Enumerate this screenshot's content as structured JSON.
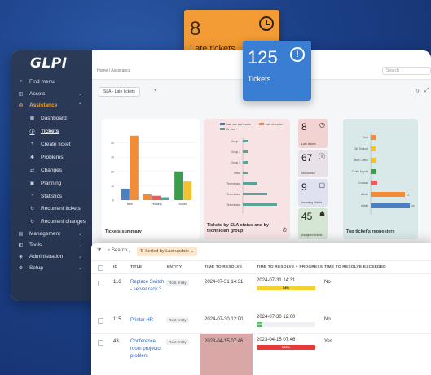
{
  "app": {
    "logo": "GLPI",
    "breadcrumb": "Home / Assistance",
    "search_placeholder": "Search"
  },
  "sidebar": {
    "items": [
      {
        "label": "Find menu",
        "icon": "search-icon"
      },
      {
        "label": "Assets",
        "icon": "box-icon"
      },
      {
        "label": "Assistance",
        "icon": "headset-icon"
      },
      {
        "label": "Dashboard",
        "icon": "dashboard-icon"
      },
      {
        "label": "Tickets",
        "icon": "alert-circle-icon"
      },
      {
        "label": "Create ticket",
        "icon": "plus-icon"
      },
      {
        "label": "Problems",
        "icon": "problem-icon"
      },
      {
        "label": "Changes",
        "icon": "changes-icon"
      },
      {
        "label": "Planning",
        "icon": "calendar-icon"
      },
      {
        "label": "Statistics",
        "icon": "statistics-icon"
      },
      {
        "label": "Recurrent tickets",
        "icon": "recurrent-icon"
      },
      {
        "label": "Recurrent changes",
        "icon": "recurrent-icon"
      },
      {
        "label": "Management",
        "icon": "wallet-icon"
      },
      {
        "label": "Tools",
        "icon": "briefcase-icon"
      },
      {
        "label": "Administration",
        "icon": "shield-icon"
      },
      {
        "label": "Setup",
        "icon": "gear-icon"
      }
    ]
  },
  "dashboard": {
    "selector": "SLA - Late tickets",
    "add": "+",
    "cards": {
      "summary_title": "Tickets summary",
      "sla_title": "Tickets by SLA status and by technician group",
      "requesters_title": "Top ticket's requesters"
    },
    "mini_cards": [
      {
        "value": "8",
        "label": "Late tickets",
        "color": "#f2d3d1"
      },
      {
        "value": "67",
        "label": "Not solved",
        "color": "#e8e1e7"
      },
      {
        "value": "9",
        "label": "Incoming tickets",
        "color": "#dfe0f0"
      },
      {
        "value": "45",
        "label": "Assigned tickets",
        "color": "#d6e6d4"
      }
    ]
  },
  "floating": {
    "late": {
      "value": "8",
      "label": "Late tickets",
      "color": "#f39c35"
    },
    "tickets": {
      "value": "125",
      "label": "Tickets",
      "color": "#3a7ed3"
    }
  },
  "table": {
    "search": "Search",
    "sorted": "Sorted by Last update",
    "columns": [
      "ID",
      "TITLE",
      "ENTITY",
      "TIME TO RESOLVE",
      "TIME TO RESOLVE + PROGRESS",
      "TIME TO RESOLVE EXCEEDED"
    ],
    "rows": [
      {
        "id": "116",
        "title": "Replace Switch - server rack 3",
        "entity": "Root entity",
        "ttr": "2024-07-31 14:31",
        "progress_date": "2024-07-31 14:31",
        "progress_pct": "54%",
        "progress_value": 0.54,
        "progress_color": "#f2d22e",
        "exceeded": "No"
      },
      {
        "id": "115",
        "title": "Printer HR",
        "entity": "Root entity",
        "ttr": "2024-07-30 12:00",
        "progress_date": "2024-07-30 12:00",
        "progress_pct": "10%",
        "progress_value": 0.1,
        "progress_color": "#44c15b",
        "exceeded": "No"
      },
      {
        "id": "43",
        "title": "Conference room projector problem",
        "entity": "Root entity",
        "ttr": "2023-04-15 07:46",
        "progress_date": "2023-04-15 07:46",
        "progress_pct": "100%",
        "progress_value": 1.0,
        "progress_color": "#e43b3b",
        "exceeded": "Yes"
      }
    ]
  },
  "chart_data": [
    {
      "type": "bar",
      "title": "Tickets summary",
      "categories": [
        "New",
        "Pending",
        "Solved"
      ],
      "ylim": [
        0,
        50
      ],
      "yticks": [
        "0",
        "10",
        "20",
        "30",
        "40"
      ],
      "series": [
        {
          "color": "#4b7fc0",
          "values": [
            8,
            0,
            0
          ]
        },
        {
          "color": "#f28c38",
          "values": [
            45,
            4,
            0
          ]
        },
        {
          "color": "#f05a5a",
          "values": [
            0,
            3,
            0
          ]
        },
        {
          "color": "#4aa79b",
          "values": [
            0,
            2,
            0
          ]
        },
        {
          "color": "#3a9d4a",
          "values": [
            0,
            0,
            20
          ]
        },
        {
          "color": "#f1c232",
          "values": [
            0,
            0,
            13
          ]
        }
      ]
    },
    {
      "type": "bar",
      "orientation": "horizontal",
      "title": "Tickets by SLA status and by technician group",
      "legend": [
        "Late own and resolve",
        "Late of resolve",
        "On time"
      ],
      "legend_colors": [
        "#4a77b5",
        "#f28c38",
        "#5aa39a"
      ],
      "categories": [
        "Group 1",
        "Group 2",
        "Group 3",
        "Office",
        "Technicians",
        "Technicians",
        "Technicians"
      ],
      "series": [
        {
          "name": "On time",
          "values": [
            1,
            1,
            1,
            1,
            3,
            5,
            7
          ]
        }
      ]
    },
    {
      "type": "bar",
      "orientation": "horizontal",
      "title": "Top ticket's requesters",
      "categories": [
        "Tech",
        "Glpi Support",
        "Marc Cotton",
        "Cedric Dupont",
        "Crosses",
        "Admin",
        "Admin"
      ],
      "values": [
        1,
        1,
        1,
        1,
        4,
        21,
        24
      ],
      "colors": [
        "#f28c38",
        "#f1c232",
        "#f1c232",
        "#3a9d4a",
        "#f05a5a",
        "#f28c38",
        "#4b7fc0"
      ]
    }
  ]
}
